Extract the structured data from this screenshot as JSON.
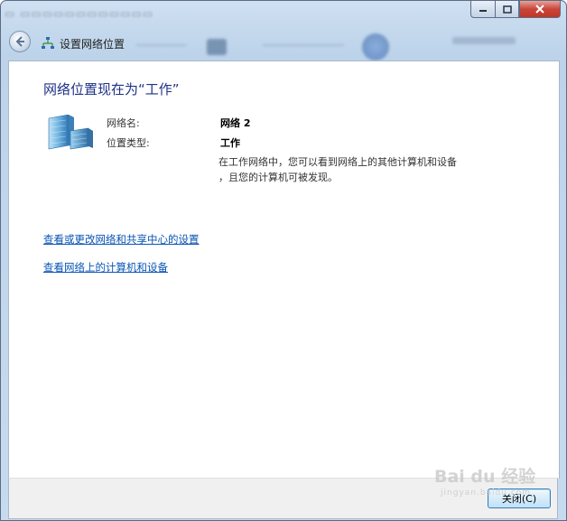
{
  "window": {
    "title_blurred": "",
    "nav_title": "设置网络位置"
  },
  "content": {
    "heading": "网络位置现在为“工作”",
    "network_name_label": "网络名:",
    "network_name_value": "网络 2",
    "location_type_label": "位置类型:",
    "location_type_value": "工作",
    "description_line1": "在工作网络中，您可以看到网络上的其他计算机和设备",
    "description_line2": "，且您的计算机可被发现。"
  },
  "links": [
    {
      "label": "查看或更改网络和共享中心的设置"
    },
    {
      "label": "查看网络上的计算机和设备"
    }
  ],
  "footer": {
    "close_button": "关闭(C)"
  },
  "watermark": {
    "brand": "Bai du 经验",
    "sub": "jingyan.baidu.com"
  }
}
